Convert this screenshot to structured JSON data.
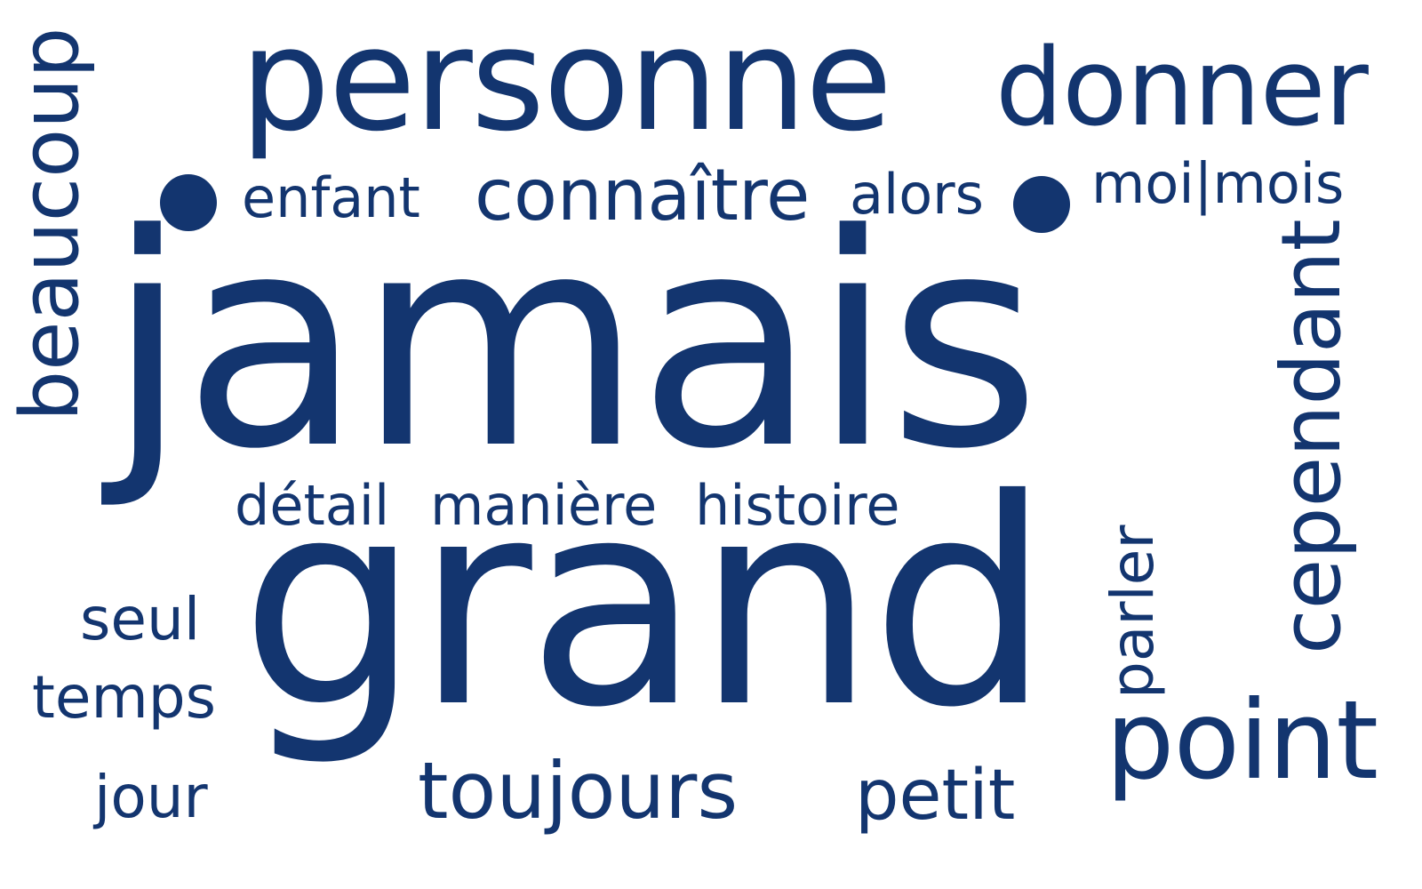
{
  "cloud": {
    "color": "#13356f",
    "background": "#ffffff",
    "words": {
      "jamais": "jamais",
      "grand": "grand",
      "personne": "personne",
      "donner": "donner",
      "enfant": "enfant",
      "connaitre": "connaître",
      "alors": "alors",
      "moi_mois": "moi|mois",
      "beaucoup": "beaucoup",
      "cependant": "cependant",
      "detail": "détail",
      "maniere": "manière",
      "histoire": "histoire",
      "seul": "seul",
      "temps": "temps",
      "jour": "jour",
      "toujours": "toujours",
      "petit": "petit",
      "parler": "parler",
      "point": "point"
    }
  }
}
